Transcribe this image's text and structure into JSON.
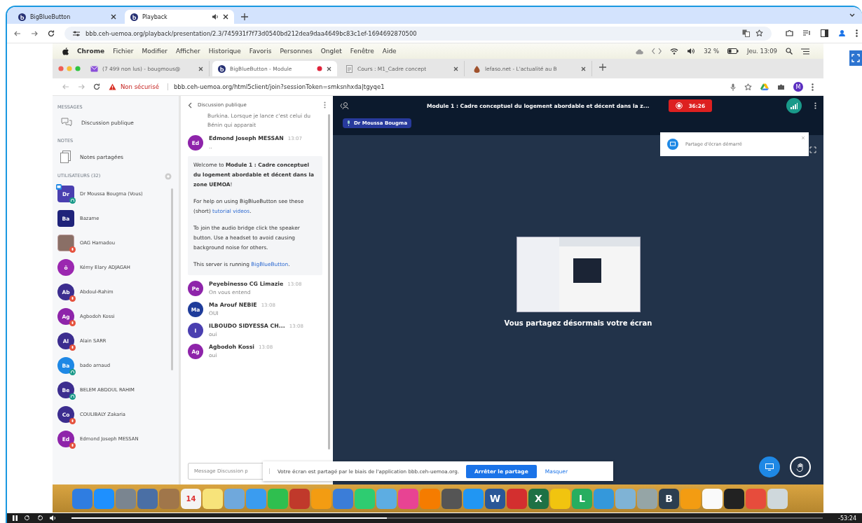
{
  "browser": {
    "tabs": [
      {
        "title": "BigBlueButton",
        "selected": false,
        "audio": false
      },
      {
        "title": "Playback",
        "selected": true,
        "audio": true
      }
    ],
    "url": "bbb.ceh-uemoa.org/playback/presentation/2.3/745931f7f73d0540bd212dea9daa4649bc83c1ef-1694692870500"
  },
  "recording": {
    "menu_bar": {
      "app": "Chrome",
      "items": [
        "Fichier",
        "Modifier",
        "Afficher",
        "Historique",
        "Favoris",
        "Personnes",
        "Onglet",
        "Fenêtre",
        "Aide"
      ],
      "battery": "32 %",
      "clock": "Jeu. 13:09"
    },
    "inner_browser": {
      "tabs": [
        {
          "title": "(7 499 non lus) - bougmous@",
          "selected": false,
          "kind": "mail"
        },
        {
          "title": "BigBlueButton - Module",
          "selected": true,
          "kind": "bbb"
        },
        {
          "title": "Cours : M1_Cadre concept",
          "selected": false,
          "kind": "doc"
        },
        {
          "title": "lefaso.net - L'actualité au B",
          "selected": false,
          "kind": "news"
        }
      ],
      "security": "Non sécurisé",
      "url": "bbb.ceh-uemoa.org/html5client/join?sessionToken=smksnhxda|tgyqe1",
      "profile": "M"
    },
    "sidebar": {
      "messages_heading": "MESSAGES",
      "chat_item": "Discussion publique",
      "notes_heading": "NOTES",
      "notes_item": "Notes partagées",
      "users_heading": "UTILISATEURS (32)",
      "users": [
        {
          "initials": "Dr",
          "name": "Dr Moussa Bougma (Vous)",
          "color": "#4a3fb0",
          "kind": "square",
          "muted": false,
          "joined": true,
          "presenter": true
        },
        {
          "initials": "Ba",
          "name": "Bazame",
          "color": "#1f237a",
          "kind": "square",
          "muted": false,
          "joined": false,
          "presenter": false
        },
        {
          "name": "OAG Hamadou",
          "color": "#8a6f66",
          "kind": "photo",
          "muted": true,
          "joined": false,
          "presenter": false
        },
        {
          "initials": "ö",
          "name": "Kémy Elary ADJAGAH",
          "color": "#9b27b0",
          "kind": "round",
          "muted": false,
          "joined": false,
          "presenter": false
        },
        {
          "initials": "Ab",
          "name": "Abdoul-Rahim",
          "color": "#3c2d8f",
          "kind": "round",
          "muted": true,
          "joined": false,
          "presenter": false
        },
        {
          "initials": "Ag",
          "name": "Agbodoh Kossi",
          "color": "#8e24aa",
          "kind": "round",
          "muted": true,
          "joined": false,
          "presenter": false
        },
        {
          "initials": "Al",
          "name": "Alain SARR",
          "color": "#3c2d8f",
          "kind": "round",
          "muted": true,
          "joined": false,
          "presenter": false
        },
        {
          "initials": "Ba",
          "name": "bado arnaud",
          "color": "#1e88e5",
          "kind": "round",
          "muted": false,
          "joined": true,
          "presenter": false
        },
        {
          "initials": "Be",
          "name": "BELEM ABDOUL RAHIM",
          "color": "#3c2d8f",
          "kind": "round",
          "muted": false,
          "joined": true,
          "presenter": false
        },
        {
          "initials": "Co",
          "name": "COULIBALY Zakaria",
          "color": "#3c2d8f",
          "kind": "round",
          "muted": true,
          "joined": false,
          "presenter": false
        },
        {
          "initials": "Ed",
          "name": "Edmond Joseph MESSAN",
          "color": "#8e24aa",
          "kind": "round",
          "muted": true,
          "joined": false,
          "presenter": false
        }
      ]
    },
    "chat": {
      "title": "Discussion publique",
      "partial_message": "Burkina. Lorsque je lance c'est celui du Bénin qui apparait",
      "before_welcome": [
        {
          "initials": "Ed",
          "author": "Edmond Joseph MESSAN",
          "time": "13:07",
          "text": "..",
          "color": "#8e24aa"
        }
      ],
      "welcome": [
        {
          "text": "Welcome to **Module 1 : Cadre conceptuel du logement abordable et décent dans la zone UEMOA**!"
        },
        {
          "before": "For help on using BigBlueButton see these (short) ",
          "link": "tutorial videos",
          "after": "."
        },
        {
          "text": "To join the audio bridge click the speaker button. Use a headset to avoid causing background noise for others."
        },
        {
          "before": "This server is running ",
          "link": "BigBlueButton",
          "after": "."
        }
      ],
      "messages": [
        {
          "initials": "Pe",
          "author": "Peyebinesso CG Limazie",
          "time": "13:08",
          "text": "On vous entend",
          "color": "#8e24aa"
        },
        {
          "initials": "Ma",
          "author": "Ma Arouf NEBIE",
          "time": "13:08",
          "text": "OUI",
          "color": "#1f3c9a"
        },
        {
          "initials": "I",
          "author": "ILBOUDO SIDYESSA CH...",
          "time": "13:08",
          "text": "oui",
          "color": "#4a3fb0"
        },
        {
          "initials": "Ag",
          "author": "Agbodoh Kossi",
          "time": "13:08",
          "text": "oui",
          "color": "#8e24aa"
        }
      ],
      "input_placeholder": "Message Discussion p"
    },
    "presentation": {
      "title": "Module 1 : Cadre conceptuel du logement abordable et décent dans la z...",
      "timer": "36:26",
      "presenter": "Dr Moussa Bougma",
      "toast": "Partage d'écran démarré",
      "status": "Vous partagez désormais votre écran"
    },
    "share_banner": {
      "text": "Votre écran est partagé par le biais de l'application bbb.ceh-uemoa.org.",
      "stop": "Arrêter le partage",
      "hide": "Masquer"
    },
    "dock": [
      {
        "color": "#2f7de1"
      },
      {
        "color": "#1e90ff"
      },
      {
        "color": "#7a8590"
      },
      {
        "color": "#4a6fa5"
      },
      {
        "color": "#a0764a"
      },
      {
        "color": "#f4f4f4",
        "glyph": "14"
      },
      {
        "color": "#f7e37a"
      },
      {
        "color": "#6fa8dc"
      },
      {
        "color": "#3a9cf0"
      },
      {
        "color": "#2fbf4f"
      },
      {
        "color": "#c0392b"
      },
      {
        "color": "#f39c12"
      },
      {
        "color": "#3b7dd8"
      },
      {
        "color": "#2ecc71"
      },
      {
        "color": "#5dade2"
      },
      {
        "color": "#e84393"
      },
      {
        "color": "#f57c00"
      },
      {
        "color": "#555555"
      },
      {
        "color": "#2196f3"
      },
      {
        "color": "#2b5797",
        "glyph": "W"
      },
      {
        "color": "#d32f2f"
      },
      {
        "color": "#1e7145",
        "glyph": "X"
      },
      {
        "color": "#f1c40f"
      },
      {
        "color": "#27ae60",
        "glyph": "L"
      },
      {
        "color": "#3498db"
      },
      {
        "color": "#7fb3d5"
      },
      {
        "color": "#95a5a6"
      },
      {
        "color": "#2c3e50",
        "glyph": "B"
      },
      {
        "color": "#f39c12"
      },
      {
        "color": "#fafafa"
      },
      {
        "color": "#222222"
      },
      {
        "color": "#e74c3c"
      },
      {
        "color": "#cfd8dc"
      }
    ]
  },
  "player": {
    "playing": true,
    "level": 0.42,
    "time": "-53:24"
  }
}
